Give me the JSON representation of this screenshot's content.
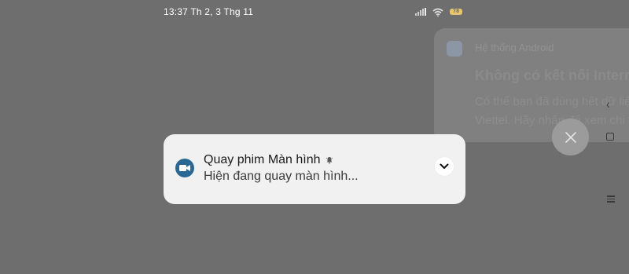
{
  "status_bar": {
    "time": "13:37 Th 2, 3 Thg 11",
    "battery_level": "78",
    "icons": [
      "signal-icon",
      "wifi-icon",
      "battery-icon"
    ]
  },
  "background_notification": {
    "app_name": "Hệ thống Android",
    "title": "Không có kết nối Internet",
    "body_line1": "Có thể bạn đã dùng hết dữ liệu",
    "body_line2": "Viettel. Hãy nhấn để xem chi tiết"
  },
  "notification": {
    "title": "Quay phim Màn hình",
    "body": "Hiện đang quay màn hình...",
    "icon": "video-camera-icon",
    "icon_color": "#2a6893"
  },
  "colors": {
    "background": "#6e6e6e",
    "card": "#f1f1f1"
  }
}
